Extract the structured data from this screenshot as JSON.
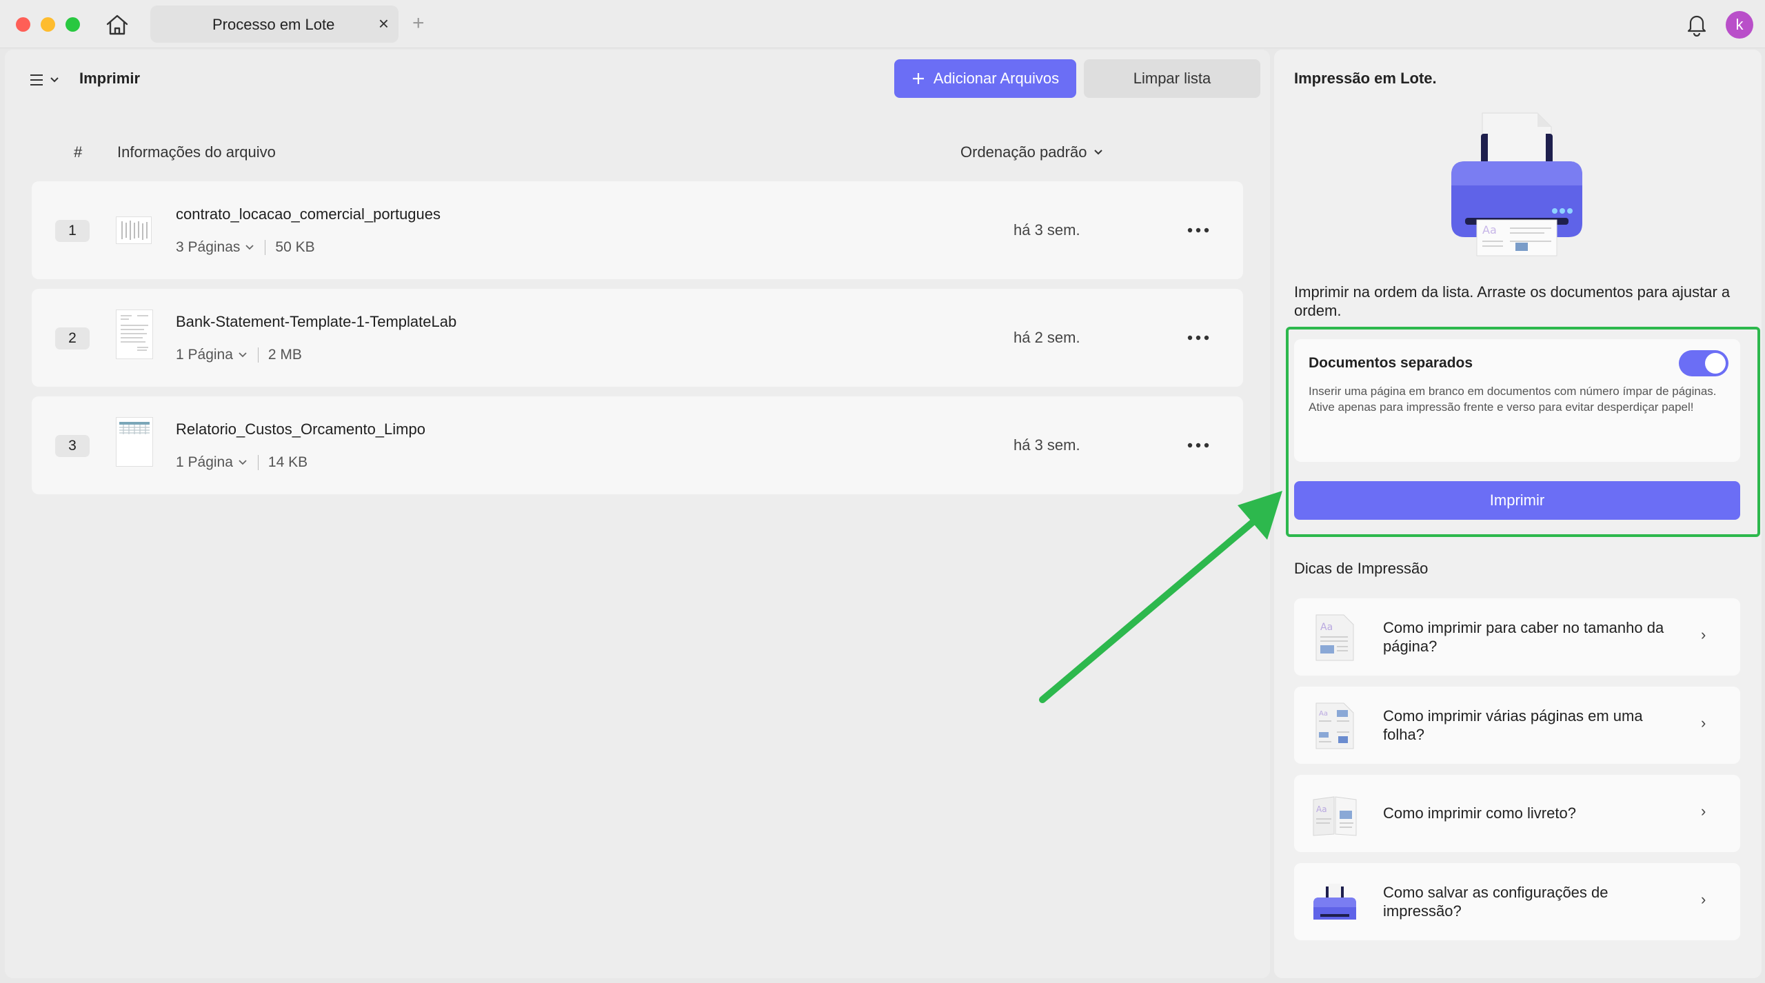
{
  "titlebar": {
    "tab_title": "Processo em Lote",
    "tab_close": "×",
    "tab_add": "+",
    "avatar_initial": "k"
  },
  "toolbar": {
    "page_title": "Imprimir",
    "add_files_label": "Adicionar Arquivos",
    "clear_list_label": "Limpar lista"
  },
  "table": {
    "col_number": "#",
    "col_info": "Informações do arquivo",
    "sort_label": "Ordenação padrão"
  },
  "files": [
    {
      "index": "1",
      "name": "contrato_locacao_comercial_portugues",
      "pages": "3 Páginas",
      "size": "50 KB",
      "date": "há 3 sem."
    },
    {
      "index": "2",
      "name": "Bank-Statement-Template-1-TemplateLab",
      "pages": "1 Página",
      "size": "2 MB",
      "date": "há 2 sem."
    },
    {
      "index": "3",
      "name": "Relatorio_Custos_Orcamento_Limpo",
      "pages": "1 Página",
      "size": "14 KB",
      "date": "há 3 sem."
    }
  ],
  "right_panel": {
    "title": "Impressão em Lote.",
    "description": "Imprimir na ordem da lista. Arraste os documentos para ajustar a ordem.",
    "separate_docs": {
      "title": "Documentos separados",
      "enabled": true,
      "desc_line1": "Inserir uma página em branco em documentos com número ímpar de páginas.",
      "desc_line2": "Ative apenas para impressão frente e verso para evitar desperdiçar papel!"
    },
    "print_button": "Imprimir",
    "tips_title": "Dicas de Impressão",
    "tips": [
      {
        "text": "Como imprimir para caber no tamanho da página?"
      },
      {
        "text": "Como imprimir várias páginas em uma folha?"
      },
      {
        "text": "Como imprimir como livreto?"
      },
      {
        "text": "Como salvar as configurações de impressão?"
      }
    ]
  },
  "colors": {
    "accent": "#6b6ef5",
    "highlight": "#2db84d",
    "avatar": "#b94fc9"
  },
  "icons": {
    "home": "home-icon",
    "bell": "bell-icon",
    "menu": "menu-icon",
    "plus": "plus-icon",
    "more": "more-icon",
    "chevron": "chevron-right-icon",
    "printer": "printer-illustration"
  }
}
